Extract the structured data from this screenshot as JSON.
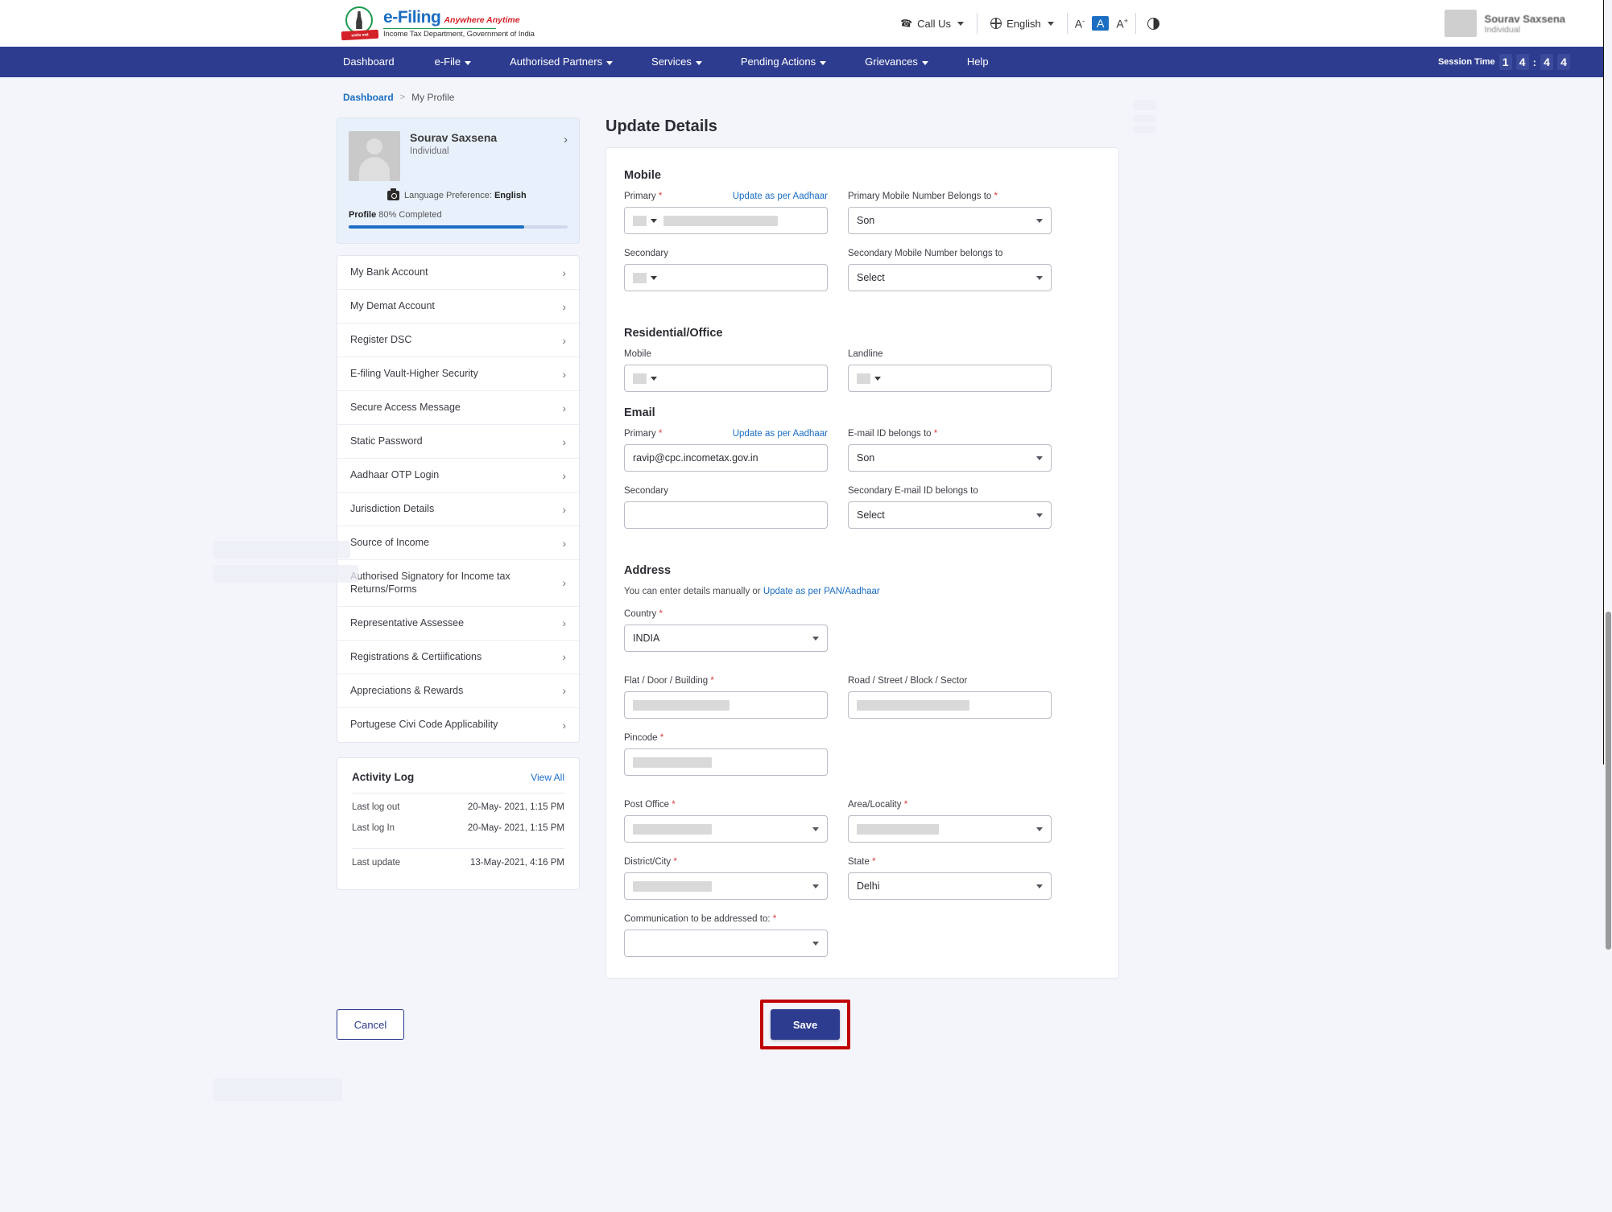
{
  "header": {
    "logo": {
      "brand": "e-Filing",
      "tagline": "Anywhere Anytime",
      "subtitle": "Income Tax Department, Government of India",
      "emblem_ribbon": "सत्यमेव जयते"
    },
    "call_us": "Call Us",
    "language": "English",
    "font_decrease": "A",
    "font_normal": "A",
    "font_increase": "A",
    "user": {
      "name": "Sourav Saxsena",
      "role": "Individual"
    }
  },
  "nav": {
    "items": [
      {
        "label": "Dashboard",
        "has_caret": false
      },
      {
        "label": "e-File",
        "has_caret": true
      },
      {
        "label": "Authorised Partners",
        "has_caret": true
      },
      {
        "label": "Services",
        "has_caret": true
      },
      {
        "label": "Pending Actions",
        "has_caret": true
      },
      {
        "label": "Grievances",
        "has_caret": true
      },
      {
        "label": "Help",
        "has_caret": false
      }
    ],
    "session_label": "Session Time",
    "session_digits": [
      "1",
      "4",
      "4",
      "4"
    ],
    "session_colon": ":"
  },
  "breadcrumb": {
    "root": "Dashboard",
    "separator": ">",
    "current": "My Profile"
  },
  "profile_card": {
    "name": "Sourav Saxsena",
    "role": "Individual",
    "language_label": "Language Preference:",
    "language_value": "English",
    "progress_bold": "Profile",
    "progress_text": "80% Completed",
    "progress_percent": 80
  },
  "sidebar_menu": [
    {
      "label": "My Bank Account"
    },
    {
      "label": "My Demat Account"
    },
    {
      "label": "Register DSC"
    },
    {
      "label": "E-filing Vault-Higher Security"
    },
    {
      "label": "Secure Access Message"
    },
    {
      "label": "Static Password"
    },
    {
      "label": "Aadhaar OTP Login"
    },
    {
      "label": "Jurisdiction Details"
    },
    {
      "label": "Source of Income"
    },
    {
      "label": "Authorised Signatory for Income tax Returns/Forms"
    },
    {
      "label": "Representative Assessee"
    },
    {
      "label": "Registrations & Certiifications"
    },
    {
      "label": "Appreciations & Rewards"
    },
    {
      "label": "Portugese Civi Code Applicability"
    }
  ],
  "activity_log": {
    "title": "Activity Log",
    "view_all": "View All",
    "rows": [
      {
        "label": "Last log out",
        "value": "20-May- 2021, 1:15 PM"
      },
      {
        "label": "Last log In",
        "value": "20-May- 2021, 1:15 PM"
      },
      {
        "label": "Last update",
        "value": "13-May-2021, 4:16 PM"
      }
    ]
  },
  "main": {
    "page_title": "Update Details",
    "mobile": {
      "section_title": "Mobile",
      "primary_label": "Primary",
      "primary_aadhaar_link": "Update as per Aadhaar",
      "primary_value": "",
      "primary_belongs_label": "Primary Mobile Number Belongs to",
      "primary_belongs_value": "Son",
      "secondary_label": "Secondary",
      "secondary_value": "",
      "secondary_belongs_label": "Secondary Mobile Number belongs to",
      "secondary_belongs_value": "Select"
    },
    "residential": {
      "section_title": "Residential/Office",
      "mobile_label": "Mobile",
      "mobile_value": "",
      "landline_label": "Landline",
      "landline_value": ""
    },
    "email": {
      "section_title": "Email",
      "primary_label": "Primary",
      "primary_aadhaar_link": "Update as per Aadhaar",
      "primary_value": "ravip@cpc.incometax.gov.in",
      "belongs_label": "E-mail ID belongs to",
      "belongs_value": "Son",
      "secondary_label": "Secondary",
      "secondary_value": "",
      "secondary_belongs_label": "Secondary E-mail ID belongs to",
      "secondary_belongs_value": "Select"
    },
    "address": {
      "section_title": "Address",
      "hint_text": "You can enter details manually or",
      "hint_link": "Update as per PAN/Aadhaar",
      "country_label": "Country",
      "country_value": "INDIA",
      "flat_label": "Flat / Door / Building",
      "flat_value": "",
      "road_label": "Road / Street / Block / Sector",
      "road_value": "",
      "pincode_label": "Pincode",
      "pincode_value": "",
      "post_office_label": "Post Office",
      "post_office_value": "",
      "area_label": "Area/Locality",
      "area_value": "",
      "district_label": "District/City",
      "district_value": "",
      "state_label": "State",
      "state_value": "Delhi",
      "communication_label": "Communication to be addressed to:",
      "communication_value": ""
    }
  },
  "footer": {
    "cancel_label": "Cancel",
    "save_label": "Save"
  },
  "colors": {
    "nav_blue": "#2e3c8f",
    "link_blue": "#1b6ec2",
    "required_red": "#e03a3a",
    "highlight_red": "#c00000",
    "profile_card_bg": "#e8f0fb"
  }
}
